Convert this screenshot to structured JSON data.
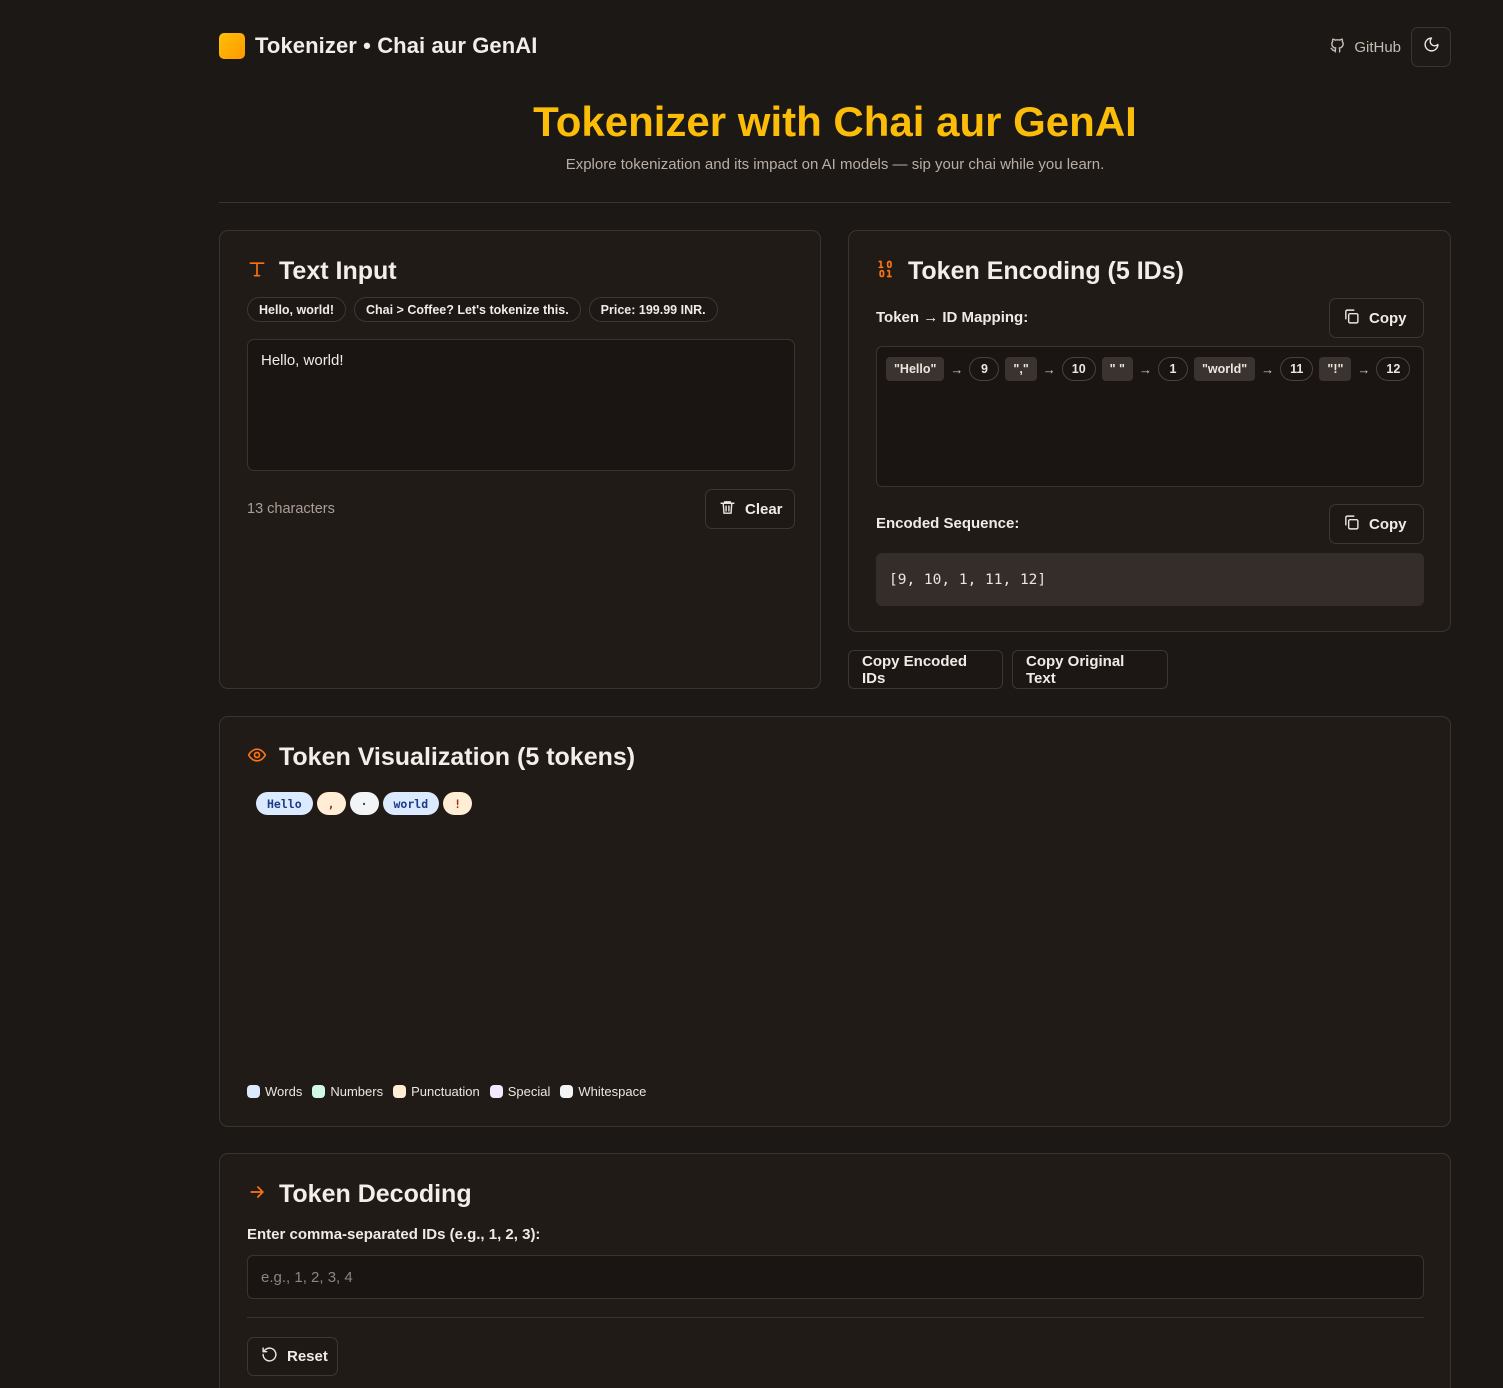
{
  "header": {
    "brand": "Tokenizer • Chai aur GenAI",
    "github_label": "GitHub",
    "icons": {
      "github": "github-icon",
      "theme": "moon-icon"
    }
  },
  "hero": {
    "title": "Tokenizer with Chai aur GenAI",
    "subtitle": "Explore tokenization and its impact on AI models — sip your chai while you learn."
  },
  "text_input": {
    "title": "Text Input",
    "examples": [
      "Hello, world!",
      "Chai > Coffee? Let's tokenize this.",
      "Price: 199.99 INR."
    ],
    "value": "Hello, world!",
    "char_count": "13 characters",
    "clear_label": "Clear"
  },
  "encoding": {
    "title": "Token Encoding (5 IDs)",
    "mapping_label": "Token → ID Mapping:",
    "copy_label": "Copy",
    "mapping": [
      {
        "token": "\"Hello\"",
        "id": "9"
      },
      {
        "token": "\",\"",
        "id": "10"
      },
      {
        "token": "\" \"",
        "id": "1"
      },
      {
        "token": "\"world\"",
        "id": "11"
      },
      {
        "token": "\"!\"",
        "id": "12"
      }
    ],
    "arrow": "→",
    "sequence_label": "Encoded Sequence:",
    "sequence": "[9, 10, 1, 11, 12]"
  },
  "actions": {
    "copy_encoded": "Copy Encoded IDs",
    "copy_original": "Copy Original Text"
  },
  "visualization": {
    "title": "Token Visualization (5 tokens)",
    "tokens": [
      {
        "text": "Hello",
        "kind": "word"
      },
      {
        "text": ",",
        "kind": "punct"
      },
      {
        "text": "·",
        "kind": "space"
      },
      {
        "text": "world",
        "kind": "word"
      },
      {
        "text": "!",
        "kind": "punct"
      }
    ],
    "legend": [
      {
        "label": "Words",
        "color": "#dbeafe"
      },
      {
        "label": "Numbers",
        "color": "#d1fae5"
      },
      {
        "label": "Punctuation",
        "color": "#ffedd5"
      },
      {
        "label": "Special",
        "color": "#f3e8ff"
      },
      {
        "label": "Whitespace",
        "color": "#f3f4f6"
      }
    ]
  },
  "decoding": {
    "title": "Token Decoding",
    "input_label": "Enter comma-separated IDs (e.g., 1, 2, 3):",
    "placeholder": "e.g., 1, 2, 3, 4",
    "reset_label": "Reset"
  },
  "colors": {
    "accent": "#fbbd08",
    "icon_accent": "#f97316",
    "background": "#1c1816",
    "card": "#211b17"
  }
}
